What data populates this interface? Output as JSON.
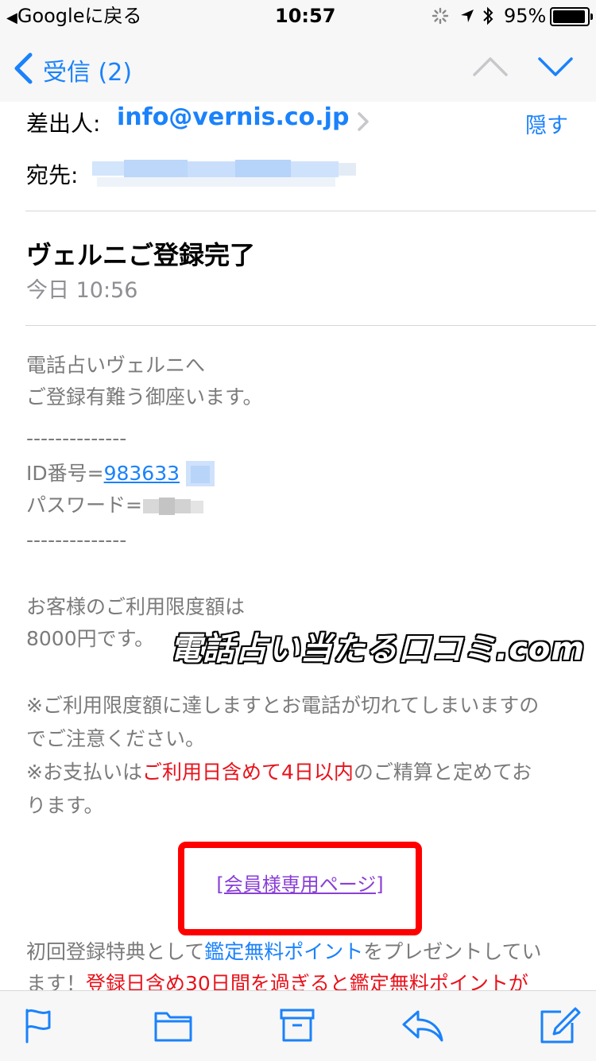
{
  "status_bar": {
    "back_app": "Googleに戻る",
    "time": "10:57",
    "battery": "95%"
  },
  "nav": {
    "back_label": "受信 (2)"
  },
  "header": {
    "from_label": "差出人:",
    "from_email": "info@vernis.co.jp",
    "hide_label": "隠す",
    "to_label": "宛先:",
    "subject": "ヴェルニご登録完了",
    "date": "今日 10:56"
  },
  "body": {
    "line1": "電話占いヴェルニへ",
    "line2": "ご登録有難う御座います。",
    "divider": "--------------",
    "id_label": "ID番号=",
    "id_value": "983633",
    "password_label": "パスワード=",
    "limit_line1": "お客様のご利用限度額は",
    "limit_line2": "8000円です。",
    "watermark": "電話占い当たる口コミ.com",
    "note1_line1": "※ご利用限度額に達しますとお電話が切れてしまいますの",
    "note1_line2": "でご注意ください。",
    "note2_prefix": "※お支払いは",
    "note2_red": "ご利用日含めて4日以内",
    "note2_suffix": "のご精算と定めてお",
    "note2_line2": "ります。",
    "member_link": "[会員様専用ページ]",
    "bonus_prefix": "初回登録特典として",
    "bonus_link": "鑑定無料ポイント",
    "bonus_suffix": "をプレゼントしてい",
    "bonus_line2_prefix": "ます！",
    "bonus_line2_red": "登録日含め30日間を過ぎると鑑定無料ポイントが"
  },
  "toolbar": {
    "icons": [
      "flag-icon",
      "folder-icon",
      "archive-icon",
      "reply-icon",
      "compose-icon"
    ]
  },
  "colors": {
    "accent": "#1a82fb",
    "red": "#e8121b",
    "highlight_box": "#ff0000",
    "link_purple": "#8a3fd6",
    "body_gray": "#7b7b7b"
  }
}
